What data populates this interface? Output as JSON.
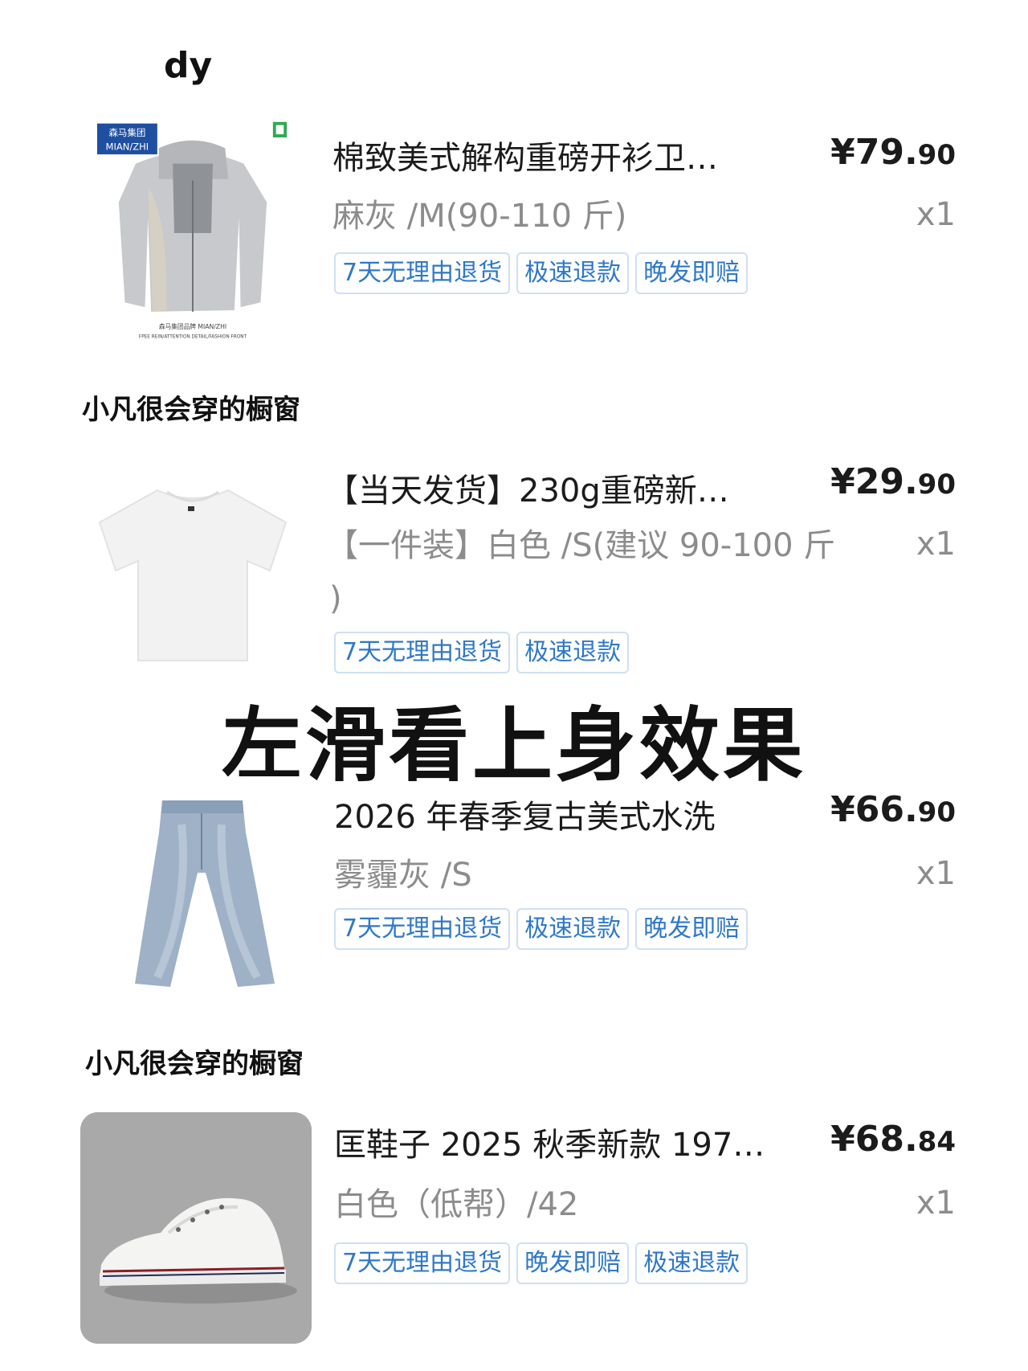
{
  "store": {
    "name": "dy"
  },
  "sections": [
    {
      "label": "小凡很会穿的橱窗"
    },
    {
      "label": "小凡很会穿的橱窗"
    }
  ],
  "overlay": {
    "caption": "左滑看上身效果"
  },
  "products": [
    {
      "title": "棉致美式解构重磅开衫卫…",
      "price_main": "¥79.",
      "price_cents": "90",
      "spec": "麻灰 /M(90-110 斤)",
      "qty": "x1",
      "tags": [
        "7天无理由退货",
        "极速退款",
        "晚发即赔"
      ],
      "image": "grey-zip-hoodie",
      "image_text": {
        "brand_line1": "森马集团",
        "brand_line2": "MIAN/ZHI",
        "caption1": "森马集团品牌 MIAN/ZHI",
        "caption2": "FPEE REIN/ATTENTION DETAIL/FASHION FRONT"
      }
    },
    {
      "title": "【当天发货】230g重磅新…",
      "price_main": "¥29.",
      "price_cents": "90",
      "spec_line1": "【一件装】白色 /S(建议 90-100 斤",
      "spec_line2": ")",
      "qty": "x1",
      "tags": [
        "7天无理由退货",
        "极速退款"
      ],
      "image": "white-tshirt"
    },
    {
      "title": "2026 年春季复古美式水洗",
      "price_main": "¥66.",
      "price_cents": "90",
      "spec": "雾霾灰 /S",
      "qty": "x1",
      "tags": [
        "7天无理由退货",
        "极速退款",
        "晚发即赔"
      ],
      "image": "light-wash-flare-jeans"
    },
    {
      "title": "匡鞋子 2025 秋季新款 197…",
      "price_main": "¥68.",
      "price_cents": "84",
      "spec": "白色（低帮）/42",
      "qty": "x1",
      "tags": [
        "7天无理由退货",
        "晚发即赔",
        "极速退款"
      ],
      "image": "white-low-top-sneaker"
    }
  ]
}
